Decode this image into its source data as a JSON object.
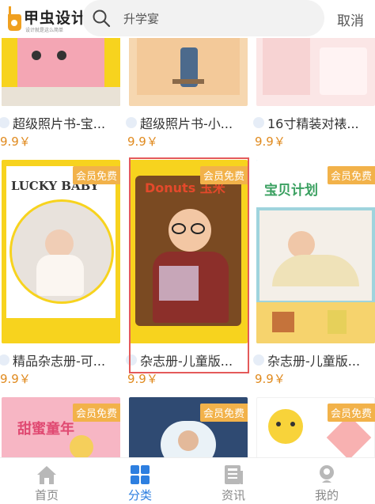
{
  "header": {
    "logo_text": "甲虫设计",
    "logo_sub": "设计就是这么简单",
    "search_value": "升学宴",
    "cancel_label": "取消"
  },
  "cards": [
    {
      "title": "超级照片书-宝...",
      "price": "9.9￥",
      "badge": ""
    },
    {
      "title": "超级照片书-小...",
      "price": "9.9￥",
      "badge": ""
    },
    {
      "title": "16寸精装对裱...",
      "price": "9.9￥",
      "badge": ""
    },
    {
      "title": "精品杂志册-可...",
      "price": "9.9￥",
      "badge": "会员免费",
      "art_text": "LUCKY BABY"
    },
    {
      "title": "杂志册-儿童版...",
      "price": "9.9￥",
      "badge": "会员免费",
      "art_text": "Donuts 玉米"
    },
    {
      "title": "杂志册-儿童版...",
      "price": "9.9￥",
      "badge": "会员免费",
      "art_text": "宝贝计划"
    },
    {
      "title": "",
      "price": "",
      "badge": "会员免费",
      "art_text": "甜蜜童年"
    },
    {
      "title": "",
      "price": "",
      "badge": "会员免费"
    },
    {
      "title": "",
      "price": "",
      "badge": "会员免费"
    }
  ],
  "tabs": [
    {
      "label": "首页",
      "icon": "home-icon"
    },
    {
      "label": "分类",
      "icon": "grid-icon"
    },
    {
      "label": "资讯",
      "icon": "news-icon"
    },
    {
      "label": "我的",
      "icon": "user-icon"
    }
  ],
  "colors": {
    "accent": "#2d7fe0",
    "price": "#e08a1e",
    "badge": "#f2b24a",
    "selection": "#e45a5a"
  }
}
